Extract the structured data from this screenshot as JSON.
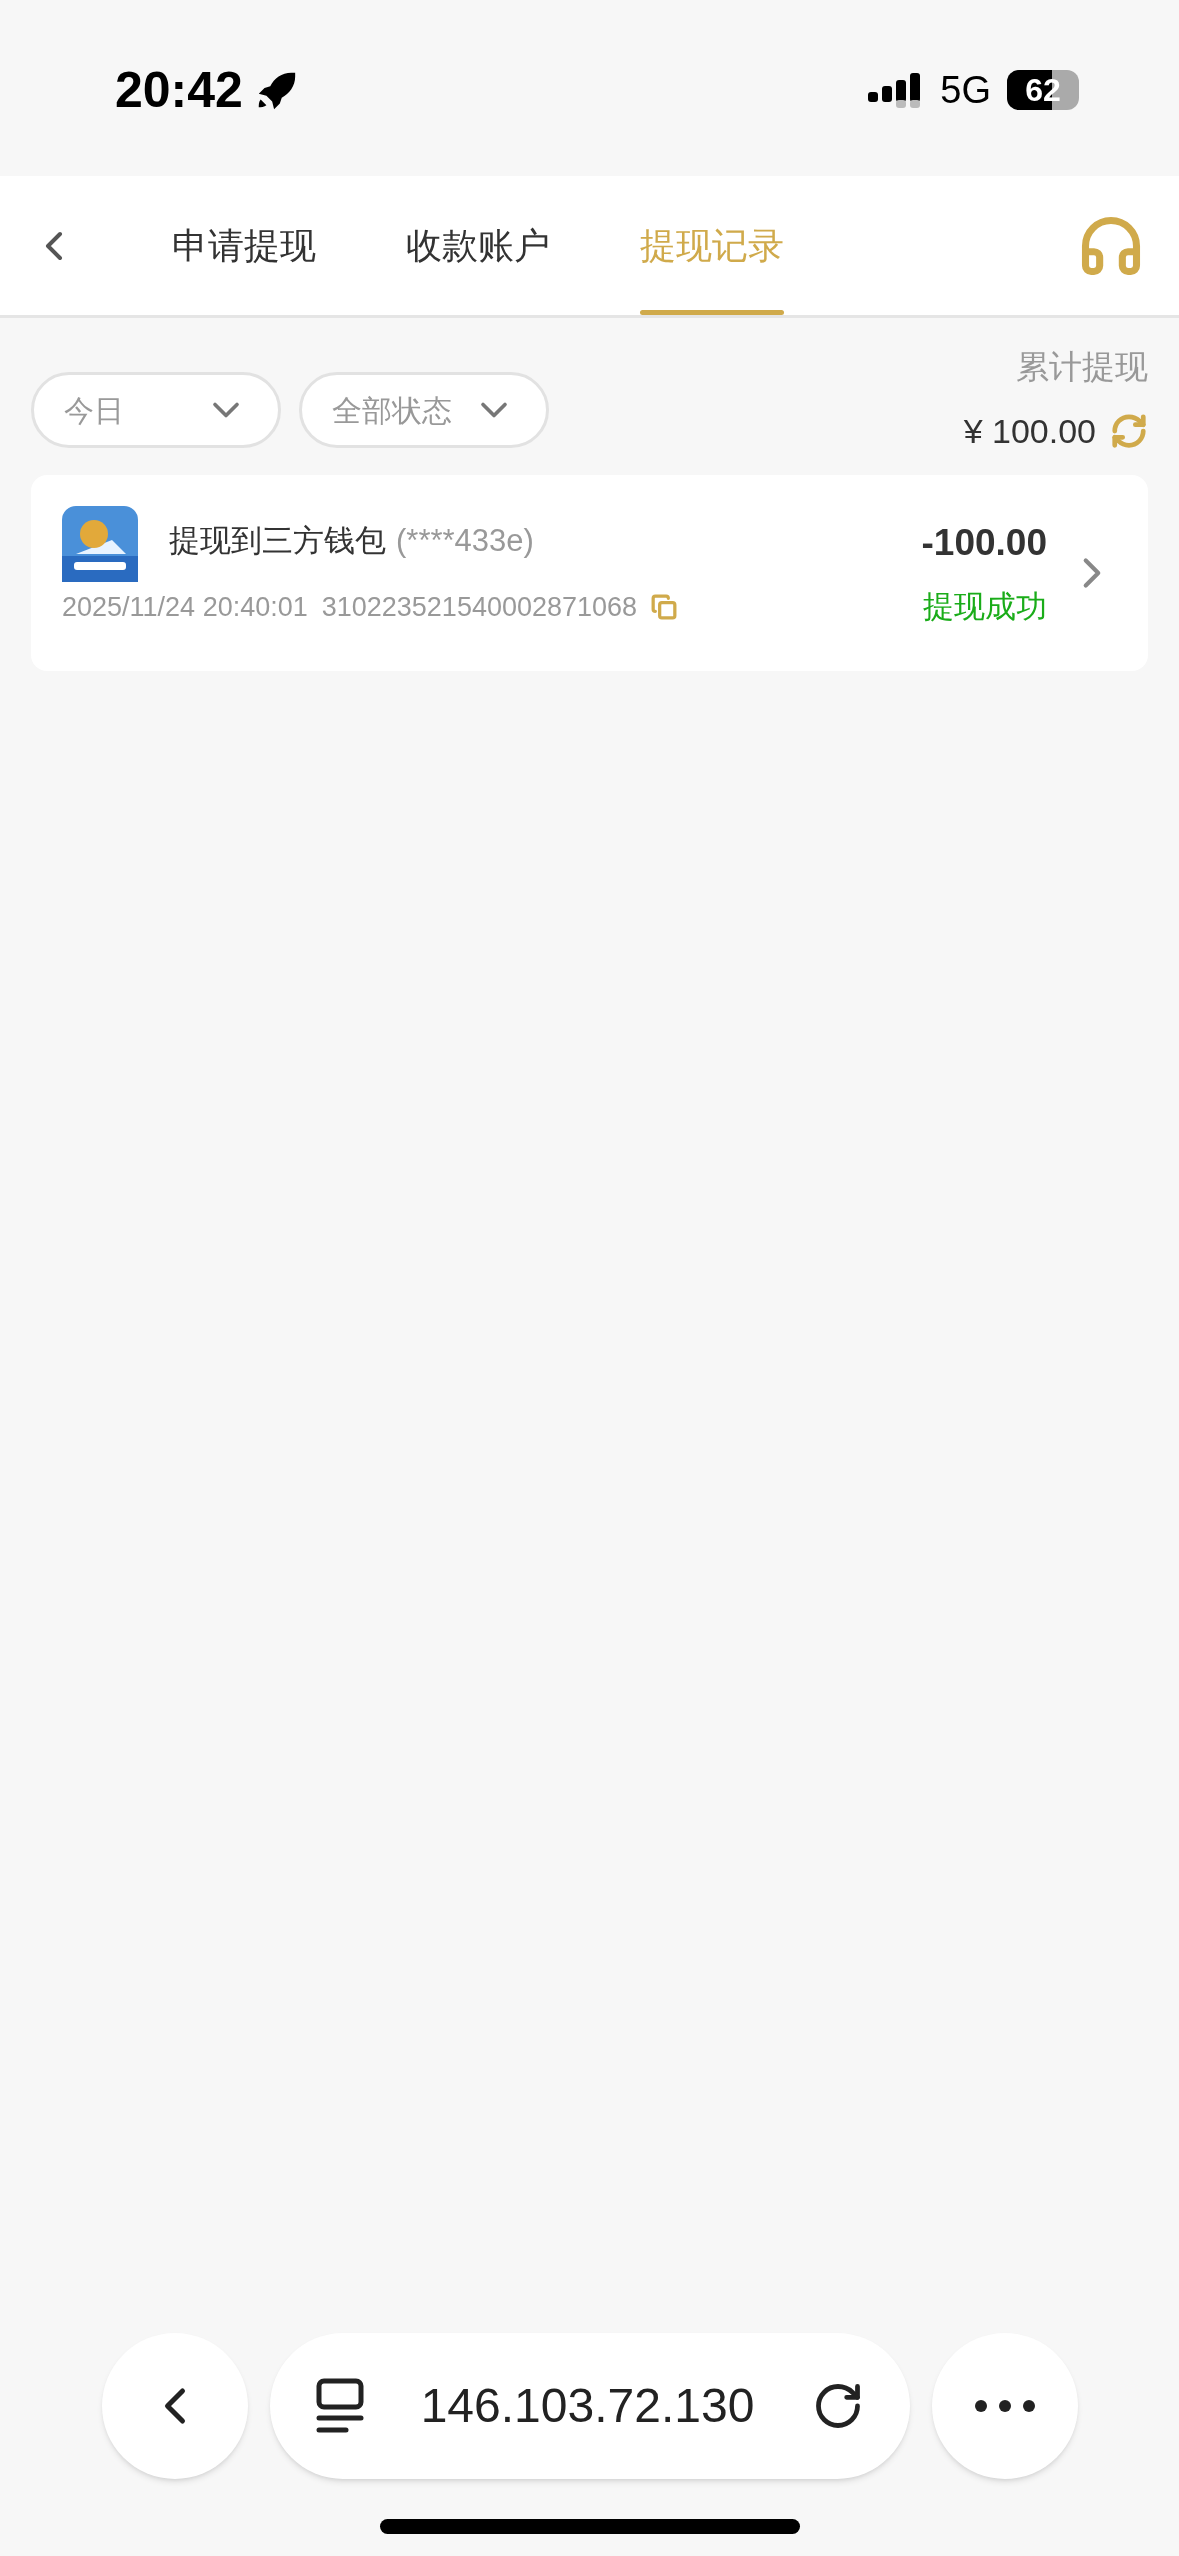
{
  "status_bar": {
    "time": "20:42",
    "network": "5G",
    "battery": "62"
  },
  "tabs": [
    {
      "label": "申请提现",
      "selected": false
    },
    {
      "label": "收款账户",
      "selected": false
    },
    {
      "label": "提现记录",
      "selected": true
    }
  ],
  "filters": [
    {
      "label": "今日"
    },
    {
      "label": "全部状态"
    }
  ],
  "total": {
    "label": "累计提现",
    "amount": "¥ 100.00"
  },
  "records": [
    {
      "title": "提现到三方钱包",
      "account": "(****433e)",
      "time": "2025/11/24 20:40:01",
      "order_no": "310223521540002871068",
      "amount": "-100.00",
      "status": "提现成功",
      "success": true
    }
  ],
  "browser": {
    "address": "146.103.72.130"
  }
}
